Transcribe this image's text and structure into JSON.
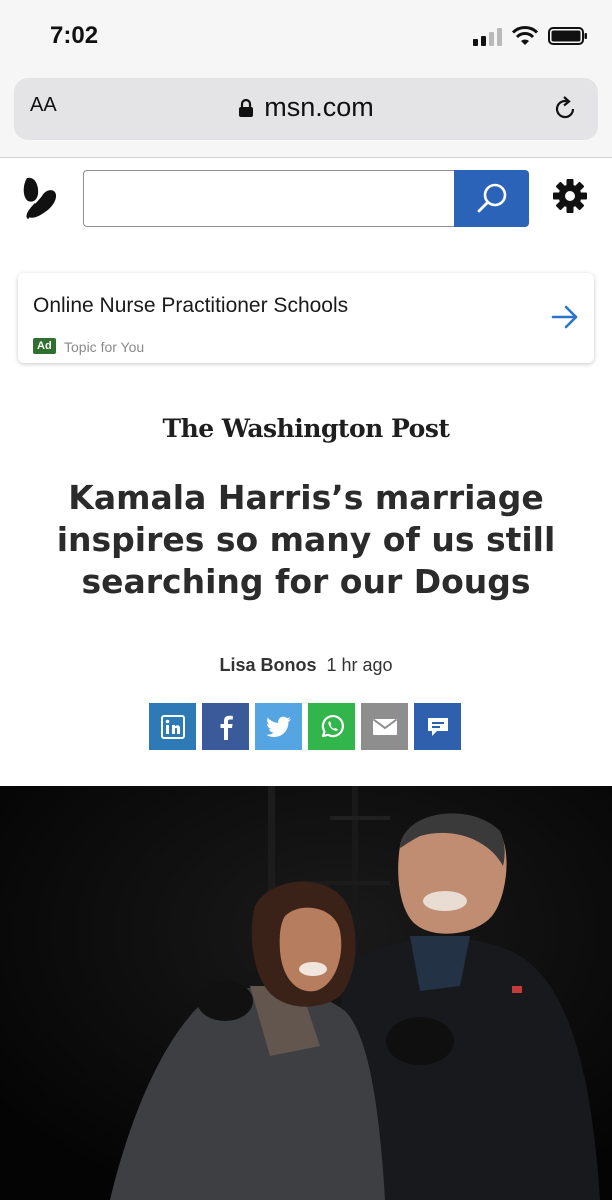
{
  "status_bar": {
    "time": "7:02"
  },
  "browser": {
    "text_size_label": "AA",
    "url": "msn.com",
    "icons": [
      "lock-icon",
      "reload-icon",
      "signal-icon",
      "wifi-icon",
      "battery-icon"
    ]
  },
  "msn": {
    "search": {
      "value": "",
      "placeholder": ""
    },
    "icons": [
      "msn-butterfly-logo",
      "search-icon",
      "gear-icon"
    ]
  },
  "ad": {
    "title": "Online Nurse Practitioner Schools",
    "badge": "Ad",
    "subtitle": "Topic for You"
  },
  "article": {
    "publisher": "The Washington Post",
    "headline": "Kamala Harris’s marriage inspires so many of us still searching for our Dougs",
    "author": "Lisa Bonos",
    "time": "1 hr ago",
    "share_buttons": [
      {
        "name": "linkedin",
        "label": "in",
        "color": "#2e7ab7"
      },
      {
        "name": "facebook",
        "label": "f",
        "color": "#3b5a9a"
      },
      {
        "name": "twitter",
        "label": "twitter",
        "color": "#55a5e3"
      },
      {
        "name": "whatsapp",
        "label": "whatsapp",
        "color": "#32b54a"
      },
      {
        "name": "email",
        "label": "email",
        "color": "#8e8e8e"
      },
      {
        "name": "comments",
        "label": "comments",
        "color": "#2e60ae"
      }
    ]
  },
  "colors": {
    "accent": "#2a63b8",
    "ad_badge": "#2f6f2f"
  }
}
